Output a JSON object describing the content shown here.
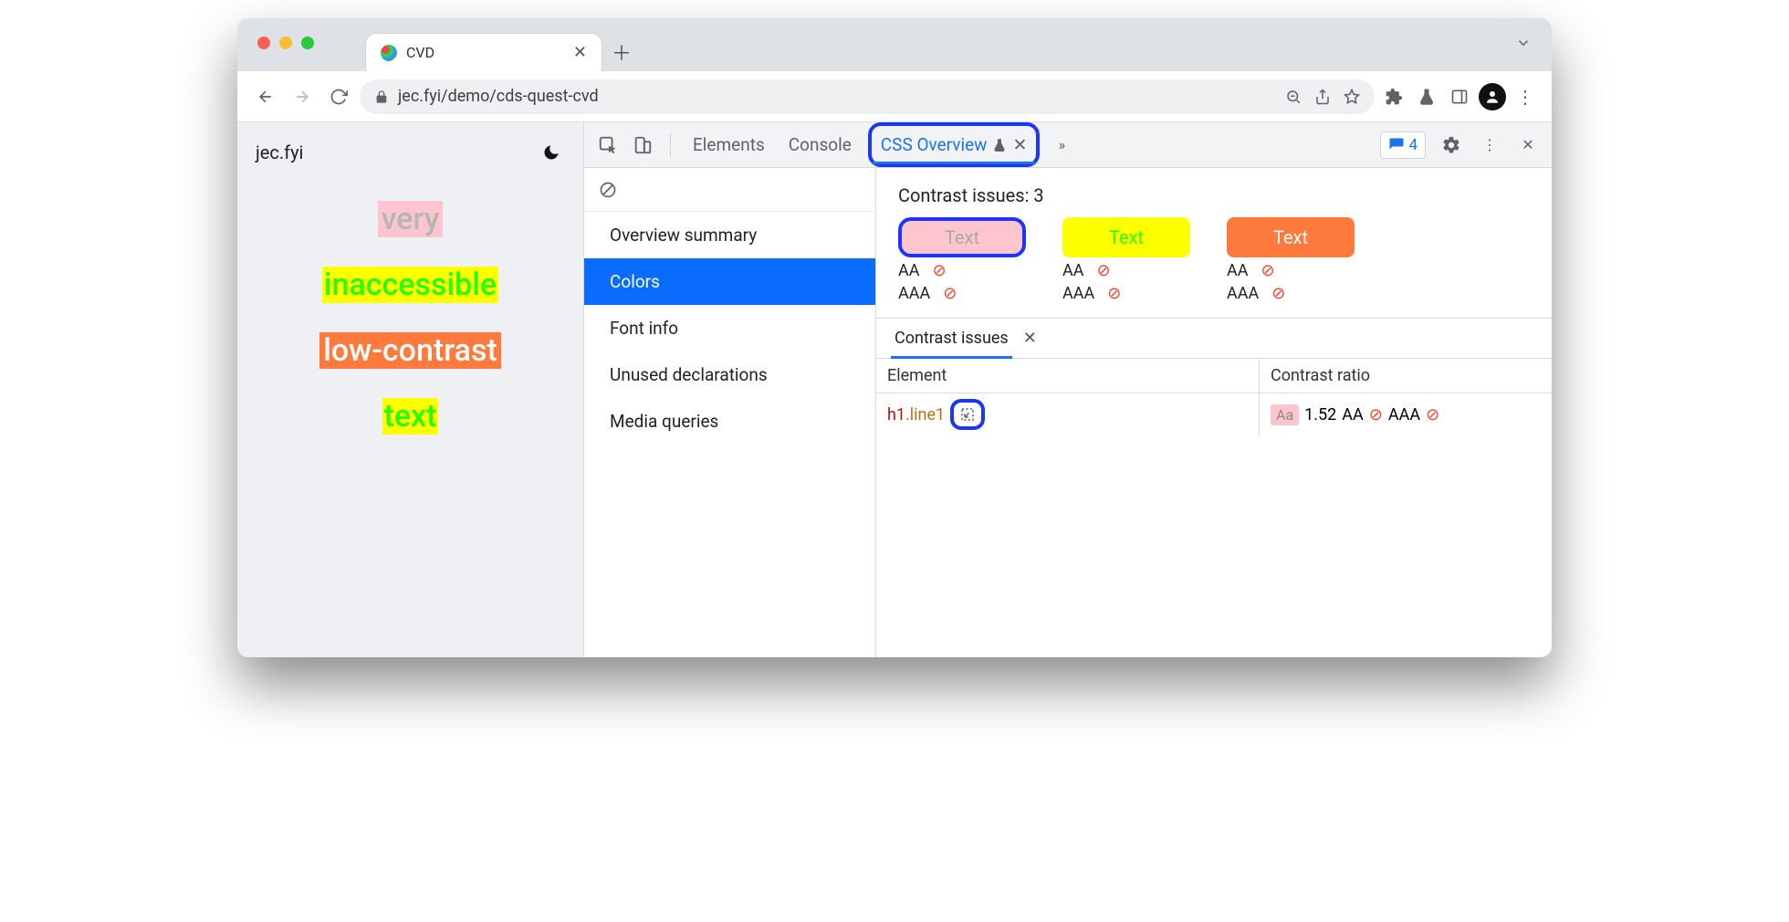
{
  "browser": {
    "tab_title": "CVD",
    "url": "jec.fyi/demo/cds-quest-cvd"
  },
  "page": {
    "site_label": "jec.fyi",
    "words": [
      "very",
      "inaccessible",
      "low-contrast",
      "text"
    ]
  },
  "devtools": {
    "tabs": {
      "elements": "Elements",
      "console": "Console",
      "cssoverview": "CSS Overview"
    },
    "issues_count": "4",
    "sidebar": {
      "items": [
        "Overview summary",
        "Colors",
        "Font info",
        "Unused declarations",
        "Media queries"
      ],
      "selected_index": 1
    },
    "contrast_header": "Contrast issues: 3",
    "swatch_text": "Text",
    "aa": "AA",
    "aaa": "AAA",
    "lower_tab": "Contrast issues",
    "table": {
      "col_element": "Element",
      "col_ratio": "Contrast ratio",
      "row": {
        "tag": "h1",
        "cls": ".line1",
        "aa_sample": "Aa",
        "ratio": "1.52",
        "aa_label": "AA",
        "aaa_label": "AAA"
      }
    }
  }
}
